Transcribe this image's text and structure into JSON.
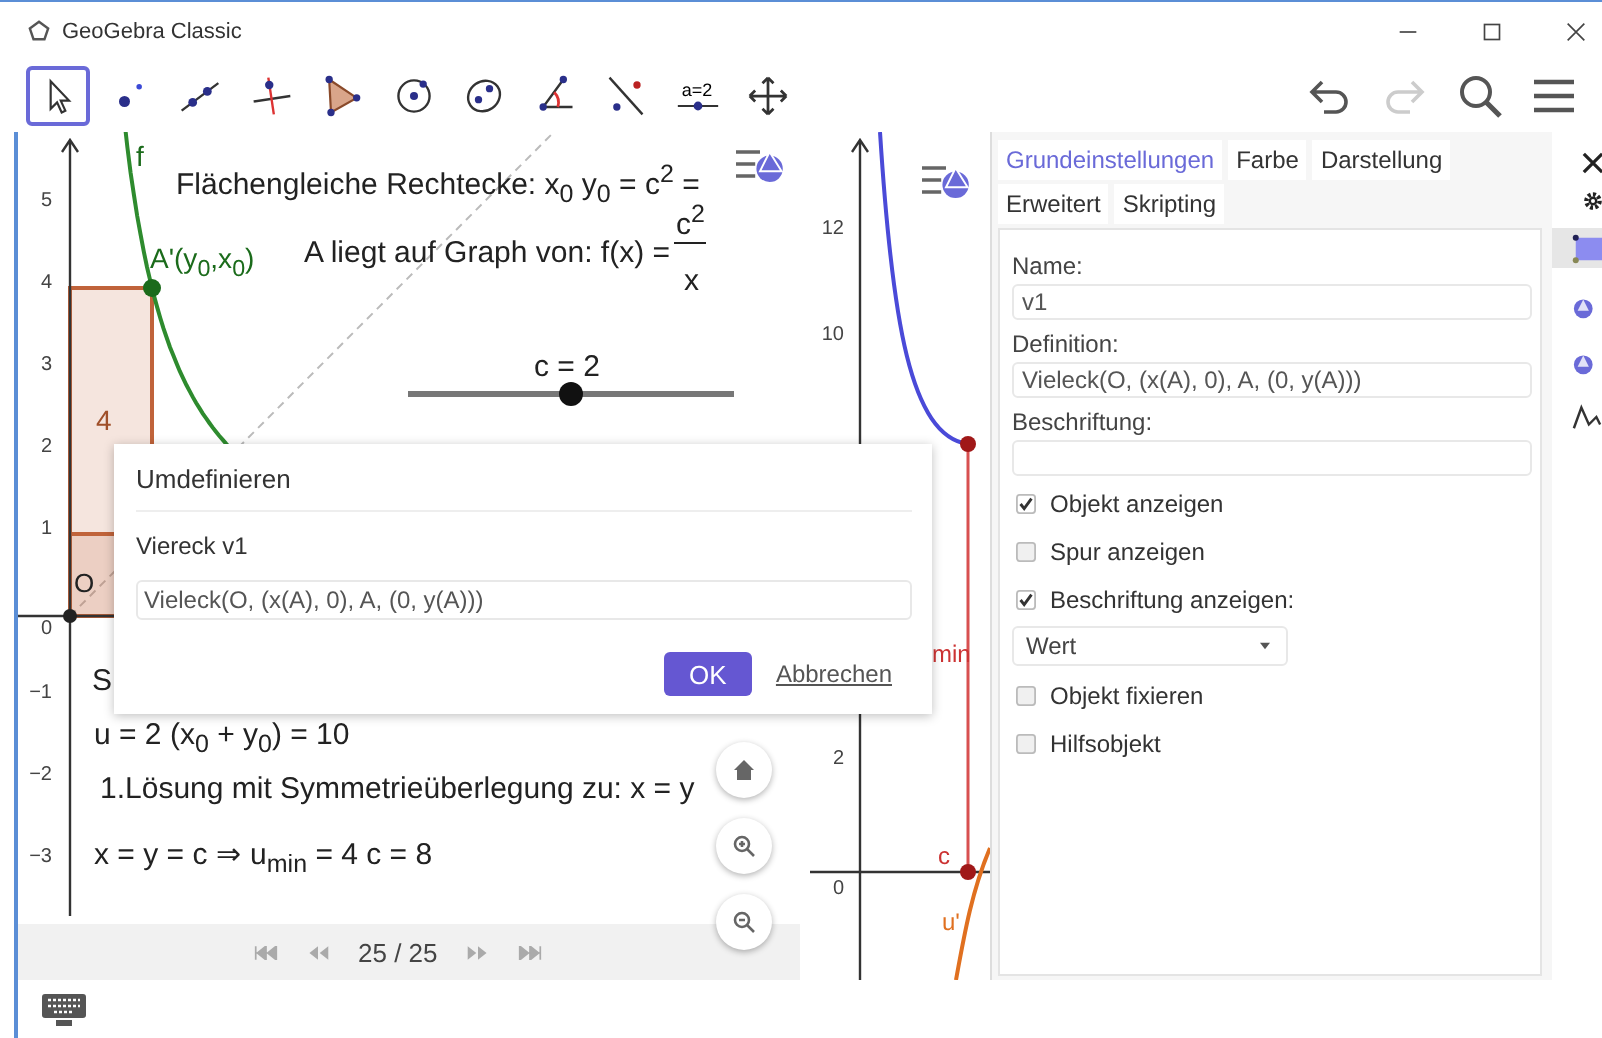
{
  "window": {
    "title": "GeoGebra Classic"
  },
  "toolbar": {
    "tools": [
      {
        "kind": "move",
        "selected": true
      },
      {
        "kind": "point",
        "selected": false
      },
      {
        "kind": "line",
        "selected": false
      },
      {
        "kind": "perpendicular",
        "selected": false
      },
      {
        "kind": "polygon",
        "selected": false
      },
      {
        "kind": "circle",
        "selected": false
      },
      {
        "kind": "ellipse",
        "selected": false
      },
      {
        "kind": "angle",
        "selected": false
      },
      {
        "kind": "reflect",
        "selected": false
      },
      {
        "kind": "slider",
        "selected": false,
        "label": "a=2"
      },
      {
        "kind": "move_view",
        "selected": false
      }
    ]
  },
  "graphics_1": {
    "y_ticks": [
      "5",
      "4",
      "3",
      "2",
      "1",
      "0",
      "−1",
      "−2",
      "−3"
    ],
    "function_label": "f",
    "heading": "Flächengleiche Rechtecke: x$_{0}$ y$_{0}$ = c$^{2}$ =",
    "point_label": "A'(y$_{0}$,x$_{0}$)",
    "graph_text": "A liegt auf Graph von: f(x) =",
    "fraction": {
      "numerator": "c$^{2}$",
      "denominator": "x"
    },
    "slider": {
      "label": "c = 2",
      "level": 0.5
    },
    "area_label": "4",
    "origin_label": "O",
    "partial_text": "S",
    "texts": [
      "u = 2 (x$_{0}$ + y$_{0}$) = 10",
      "1.Lösung mit Symmetrieüberlegung zu:  x = y",
      "x = y = c ⇒ u$_{min}$ = 4 c = 8"
    ],
    "navigation": {
      "page": "25 / 25"
    }
  },
  "graphics_2": {
    "y_ticks": [
      "12",
      "10",
      "2",
      "0"
    ],
    "labels": [
      {
        "text": "min",
        "color": "#cc3333"
      },
      {
        "text": "c",
        "color": "#cc3333"
      },
      {
        "text": "u'",
        "color": "#e07020"
      }
    ]
  },
  "dialog": {
    "title": "Umdefinieren",
    "object": "Viereck v1",
    "value": "Vieleck(O, (x(A), 0), A, (0, y(A)))",
    "ok": "OK",
    "cancel": "Abbrechen"
  },
  "properties": {
    "tabs": [
      {
        "label": "Grundeinstellungen",
        "selected": true
      },
      {
        "label": "Farbe",
        "selected": false
      },
      {
        "label": "Darstellung",
        "selected": false
      },
      {
        "label": "Erweitert",
        "selected": false
      },
      {
        "label": "Skripting",
        "selected": false
      }
    ],
    "fields": [
      {
        "label": "Name:",
        "value": "v1"
      },
      {
        "label": "Definition:",
        "value": "Vieleck(O, (x(A), 0), A, (0, y(A)))"
      },
      {
        "label": "Beschriftung:"
      }
    ],
    "options": [
      {
        "kind": "checkbox",
        "label": "Objekt anzeigen",
        "checked": true
      },
      {
        "kind": "checkbox",
        "label": "Spur anzeigen",
        "checked": false
      },
      {
        "kind": "checkbox",
        "label": "Beschriftung anzeigen:",
        "checked": true
      },
      {
        "kind": "dropdown",
        "value": "Wert"
      },
      {
        "kind": "checkbox",
        "label": "Objekt fixieren",
        "checked": false
      },
      {
        "kind": "checkbox",
        "label": "Hilfsobjekt",
        "checked": false
      }
    ]
  },
  "object_types": [
    {
      "kind": "polygon",
      "selected": true
    },
    {
      "kind": "point",
      "selected": false
    },
    {
      "kind": "point",
      "selected": false
    },
    {
      "kind": "function",
      "selected": false
    }
  ]
}
